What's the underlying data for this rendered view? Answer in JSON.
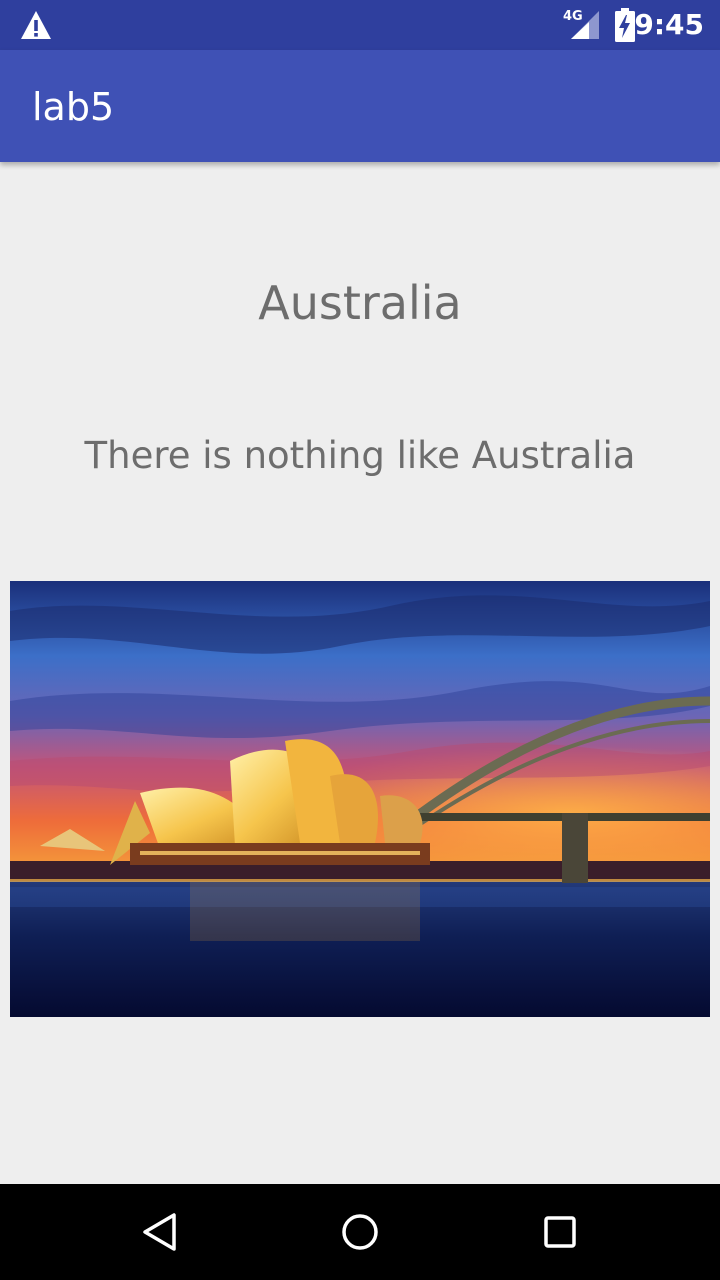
{
  "status_bar": {
    "time": "9:45",
    "network_label": "4G",
    "icons": [
      "warning-icon",
      "signal-icon",
      "battery-charging-icon"
    ]
  },
  "app_bar": {
    "title": "lab5",
    "color": "#3f51b5"
  },
  "content": {
    "heading": "Australia",
    "subheading": "There is nothing like Australia",
    "image": "sydney-opera-house-harbour-bridge-sunset-photo"
  },
  "nav_bar": {
    "buttons": [
      "back-icon",
      "home-icon",
      "recents-icon"
    ]
  }
}
